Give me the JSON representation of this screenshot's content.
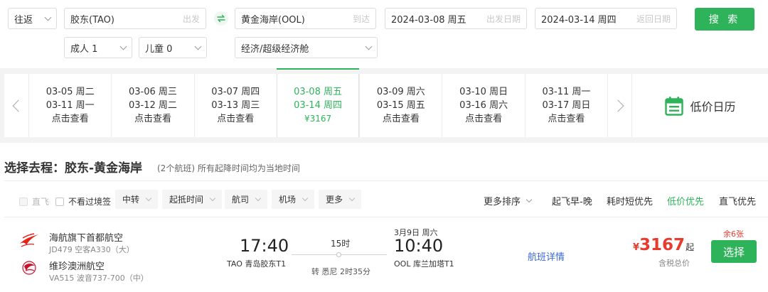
{
  "search": {
    "trip_type": "往返",
    "origin": {
      "value": "胶东(TAO)",
      "hint": "出发"
    },
    "destination": {
      "value": "黄金海岸(OOL)",
      "hint": "到达"
    },
    "depart_date": {
      "value": "2024-03-08 周五",
      "hint": "出发日期"
    },
    "return_date": {
      "value": "2024-03-14 周四",
      "hint": "返回日期"
    },
    "adults": "成人 1",
    "children": "儿童 0",
    "cabin": "经济/超级经济舱",
    "search_label": "搜 索"
  },
  "date_strip": {
    "days": [
      {
        "depart": "03-05 周二",
        "return": "03-11 周一",
        "info": "点击查看"
      },
      {
        "depart": "03-06 周三",
        "return": "03-12 周二",
        "info": "点击查看"
      },
      {
        "depart": "03-07 周四",
        "return": "03-13 周三",
        "info": "点击查看"
      },
      {
        "depart": "03-08 周五",
        "return": "03-14 周四",
        "info": "¥3167"
      },
      {
        "depart": "03-09 周六",
        "return": "03-15 周五",
        "info": "点击查看"
      },
      {
        "depart": "03-10 周日",
        "return": "03-16 周六",
        "info": "点击查看"
      },
      {
        "depart": "03-11 周一",
        "return": "03-17 周日",
        "info": "点击查看"
      }
    ],
    "calendar_label": "低价日历"
  },
  "heading": {
    "title": "选择去程：胶东-黄金海岸",
    "subtitle": "(2个航班) 所有起降时间均为当地时间"
  },
  "filters": {
    "direct_only": "直飞",
    "no_transit_visa": "不看过境签",
    "dropdowns": [
      "中转",
      "起抵时间",
      "航司",
      "机场",
      "更多"
    ],
    "more_sort": "更多排序",
    "sorts": [
      "起飞早-晚",
      "耗时短优先",
      "低价优先",
      "直飞优先"
    ]
  },
  "flight": {
    "airline1": {
      "name": "海航旗下首都航空",
      "sub": "JD479 空客A330（大）"
    },
    "airline2": {
      "name": "维珍澳洲航空",
      "sub": "VA515 波音737-700（中）"
    },
    "dep_time": "17:40",
    "dep_airport": "TAO 青岛胶东T1",
    "duration": "15时",
    "transfer": "转 悉尼 2时35分",
    "arr_date": "3月9日 周六",
    "arr_time": "10:40",
    "arr_airport": "OOL 库兰加塔T1",
    "detail_label": "航班详情",
    "currency": "¥",
    "price": "3167",
    "price_suffix": "起",
    "tax_note": "含税总价",
    "seats_left": "余6张",
    "select_label": "选择"
  },
  "colors": {
    "accent": "#2fb35a",
    "price": "#e63b2e",
    "link": "#3867d6"
  }
}
